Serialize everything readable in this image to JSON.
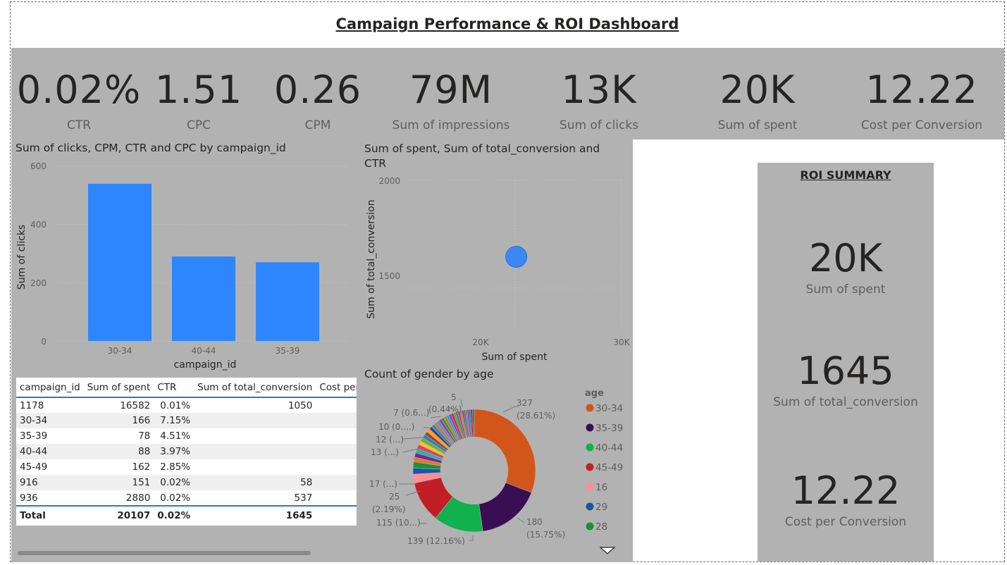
{
  "title": "Campaign Performance & ROI Dashboard",
  "kpis": [
    {
      "value": "0.02%",
      "label": "CTR"
    },
    {
      "value": "1.51",
      "label": "CPC"
    },
    {
      "value": "0.26",
      "label": "CPM"
    },
    {
      "value": "79M",
      "label": "Sum of impressions"
    },
    {
      "value": "13K",
      "label": "Sum of clicks"
    },
    {
      "value": "20K",
      "label": "Sum of spent"
    },
    {
      "value": "12.22",
      "label": "Cost per Conversion"
    }
  ],
  "bar_chart": {
    "title": "Sum of clicks, CPM, CTR and CPC by campaign_id",
    "xlabel": "campaign_id",
    "ylabel": "Sum of clicks",
    "yticks": [
      "0",
      "200",
      "400",
      "600"
    ],
    "color": "#2e86ff"
  },
  "scatter_chart": {
    "title": "Sum of spent, Sum of total_conversion and CTR",
    "xlabel": "Sum of spent",
    "ylabel": "Sum of total_conversion",
    "xticks": [
      "20K",
      "30K"
    ],
    "yticks": [
      "1500",
      "2000"
    ],
    "color": "#3d87f5"
  },
  "donut_chart": {
    "title": "Count of gender by age",
    "legend_title": "age",
    "labels": {
      "l327": "327",
      "l327p": "(28.61%)",
      "l180": "180",
      "l180p": "(15.75%)",
      "l139": "139 (12.16%)",
      "l115": "115 (10...)",
      "l25": "25",
      "l25p": "(2.19%)",
      "l17": "17 (...)",
      "l13": "13 (...)",
      "l12": "12 (...)",
      "l10": "10 (0....)",
      "l7": "7 (0.6...)",
      "l5": "5",
      "l5p": "(0.44%)"
    }
  },
  "table": {
    "headers": [
      "campaign_id",
      "Sum of spent",
      "CTR",
      "Sum of total_conversion",
      "Cost per C"
    ],
    "rows": [
      [
        "1178",
        "16582",
        "0.01%",
        "1050",
        ""
      ],
      [
        "30-34",
        "166",
        "7.15%",
        "",
        ""
      ],
      [
        "35-39",
        "78",
        "4.51%",
        "",
        ""
      ],
      [
        "40-44",
        "88",
        "3.97%",
        "",
        ""
      ],
      [
        "45-49",
        "162",
        "2.85%",
        "",
        ""
      ],
      [
        "916",
        "151",
        "0.02%",
        "58",
        ""
      ],
      [
        "936",
        "2880",
        "0.02%",
        "537",
        ""
      ]
    ],
    "total": [
      "Total",
      "20107",
      "0.02%",
      "1645",
      ""
    ]
  },
  "roi": {
    "title": "ROI SUMMARY",
    "items": [
      {
        "value": "20K",
        "label": "Sum of spent"
      },
      {
        "value": "1645",
        "label": "Sum of total_conversion"
      },
      {
        "value": "12.22",
        "label": "Cost per Conversion"
      }
    ]
  },
  "chart_data": [
    {
      "type": "bar",
      "title": "Sum of clicks, CPM, CTR and CPC by campaign_id",
      "xlabel": "campaign_id",
      "ylabel": "Sum of clicks",
      "categories": [
        "30-34",
        "40-44",
        "35-39"
      ],
      "values": [
        540,
        290,
        270
      ],
      "ylim": [
        0,
        600
      ],
      "grid": true
    },
    {
      "type": "scatter",
      "title": "Sum of spent, Sum of total_conversion and CTR",
      "xlabel": "Sum of spent",
      "ylabel": "Sum of total_conversion",
      "points": [
        {
          "x": 20107,
          "y": 1645
        }
      ],
      "xlim": [
        10000,
        30000
      ],
      "ylim": [
        1300,
        2000
      ],
      "grid": true
    },
    {
      "type": "pie",
      "title": "Count of gender by age",
      "legend_title": "age",
      "legend": [
        "30-34",
        "35-39",
        "40-44",
        "45-49",
        "16",
        "29",
        "28"
      ],
      "slices": [
        {
          "label": "30-34",
          "value": 327,
          "color": "#d2561b"
        },
        {
          "label": "35-39",
          "value": 180,
          "color": "#3a0e52"
        },
        {
          "label": "40-44",
          "value": 139,
          "color": "#10b14e"
        },
        {
          "label": "45-49",
          "value": 115,
          "color": "#c01f25"
        },
        {
          "label": "16",
          "value": 25,
          "color": "#ff8f94"
        },
        {
          "label": "29",
          "value": 17,
          "color": "#1a56a8"
        },
        {
          "label": "28",
          "value": 17,
          "color": "#17913a"
        }
      ],
      "other_slices": [
        13,
        13,
        12,
        12,
        11,
        11,
        10,
        10,
        10,
        9,
        9,
        9,
        8,
        8,
        8,
        8,
        7,
        7,
        7,
        6,
        6,
        6,
        6,
        5,
        5,
        5,
        5,
        5,
        5,
        5
      ],
      "other_colors": [
        "#e07b24",
        "#7a1fa0",
        "#1fb8a0",
        "#e23b6b",
        "#f2c811",
        "#6ab04c",
        "#2c7fb8",
        "#a04040",
        "#ffa600",
        "#5c2d91",
        "#00a2ad",
        "#e66c37",
        "#4b8bf4",
        "#b83280",
        "#16a34a",
        "#d97706",
        "#0ea5e9",
        "#9333ea",
        "#dc2626",
        "#65a30d",
        "#0891b2",
        "#db2777",
        "#ca8a04",
        "#4f46e5",
        "#059669",
        "#ea580c",
        "#7c3aed",
        "#0284c7",
        "#be123c",
        "#15803d"
      ],
      "hole": 0.55
    }
  ]
}
